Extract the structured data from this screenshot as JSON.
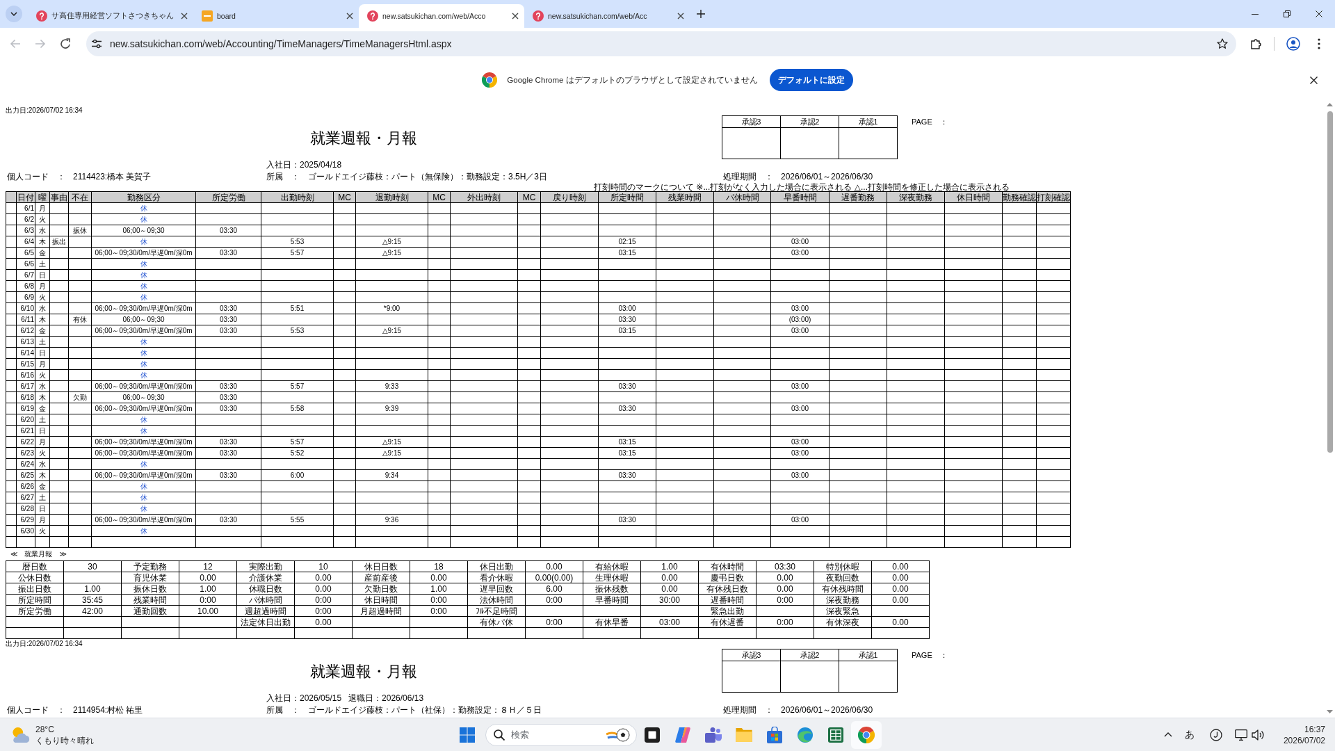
{
  "browser": {
    "tabs": [
      {
        "title": "サ高住専用経営ソフトさつきちゃん",
        "kind": "help",
        "selected": false
      },
      {
        "title": "board",
        "kind": "board",
        "selected": false
      },
      {
        "title": "new.satsukichan.com/web/Acco",
        "kind": "help",
        "selected": true
      },
      {
        "title": "new.satsukichan.com/web/Acc",
        "kind": "help",
        "selected": false
      }
    ],
    "nav": [
      {
        "kind": "back",
        "disabled": true
      },
      {
        "kind": "forward",
        "disabled": true
      },
      {
        "kind": "reload",
        "disabled": false
      }
    ],
    "url": "new.satsukichan.com/web/Accounting/TimeManagers/TimeManagersHtml.aspx"
  },
  "infobar": {
    "message": "Google Chrome はデフォルトのブラウザとして設定されていません",
    "button": "デフォルトに設定"
  },
  "reports": [
    {
      "output_date": "出力日:2026/07/02 16:34",
      "title": "就業週報・月報",
      "approvals": [
        "承認3",
        "承認2",
        "承認1"
      ],
      "page_label": "PAGE　：",
      "dates": [
        "入社日：2025/04/18"
      ],
      "employee": {
        "label": "個人コード　：",
        "value": "2114423:橋本 美賀子"
      },
      "department": {
        "label": "所属　：",
        "value": "ゴールドエイジ藤枝：パート（無保険）：勤務設定：3.5H／3日"
      },
      "period": {
        "label": "処理期間　：",
        "value": "2026/06/01～2026/06/30"
      },
      "note": "打刻時間のマークについて ※...打刻がなく入力した場合に表示される △...打刻時間を修正した場合に表示される",
      "table": {
        "columns": [
          "日付",
          "曜",
          "事由",
          "不在",
          "勤務区分",
          "所定労働",
          "出勤時刻",
          "MC",
          "退勤時刻",
          "MC",
          "外出時刻",
          "MC",
          "戻り時刻",
          "所定時間",
          "残業時間",
          "パ休時間",
          "早番時間",
          "遅番勤務",
          "深夜勤務",
          "休日時間",
          "勤務確認",
          "打刻確認"
        ],
        "rows": [
          {
            "kind": "rest",
            "date": "6/1",
            "weekday": "月",
            "shift": "休"
          },
          {
            "kind": "rest",
            "date": "6/2",
            "weekday": "火",
            "shift": "休"
          },
          {
            "kind": "work",
            "date": "6/3",
            "weekday": "水",
            "absence": "振休",
            "shift": "06;00～09;30",
            "labor": "03:30"
          },
          {
            "kind": "rest",
            "date": "6/4",
            "weekday": "木",
            "reason": "振出",
            "shift": "休",
            "clock_in": "5:53",
            "clock_out": "△9:15",
            "scheduled": "02:15",
            "early": "03:00"
          },
          {
            "kind": "work",
            "date": "6/5",
            "weekday": "金",
            "shift": "06;00～09;30/0m/早遅0m/深0m",
            "labor": "03:30",
            "clock_in": "5:57",
            "clock_out": "△9:15",
            "scheduled": "03:15",
            "early": "03:00"
          },
          {
            "kind": "rest",
            "date": "6/6",
            "weekday": "土",
            "shift": "休"
          },
          {
            "kind": "rest",
            "date": "6/7",
            "weekday": "日",
            "shift": "休"
          },
          {
            "kind": "rest",
            "date": "6/8",
            "weekday": "月",
            "shift": "休"
          },
          {
            "kind": "rest",
            "date": "6/9",
            "weekday": "火",
            "shift": "休"
          },
          {
            "kind": "work",
            "date": "6/10",
            "weekday": "水",
            "shift": "06;00～09;30/0m/早遅0m/深0m",
            "labor": "03:30",
            "clock_in": "5:51",
            "clock_out": "*9:00",
            "scheduled": "03:00",
            "early": "03:00"
          },
          {
            "kind": "work",
            "date": "6/11",
            "weekday": "木",
            "absence": "有休",
            "shift": "06;00～09;30",
            "labor": "03:30",
            "scheduled": "03:30",
            "early": "(03:00)"
          },
          {
            "kind": "work",
            "date": "6/12",
            "weekday": "金",
            "shift": "06;00～09;30/0m/早遅0m/深0m",
            "labor": "03:30",
            "clock_in": "5:53",
            "clock_out": "△9:15",
            "scheduled": "03:15",
            "early": "03:00"
          },
          {
            "kind": "rest",
            "date": "6/13",
            "weekday": "土",
            "shift": "休"
          },
          {
            "kind": "rest",
            "date": "6/14",
            "weekday": "日",
            "shift": "休"
          },
          {
            "kind": "rest",
            "date": "6/15",
            "weekday": "月",
            "shift": "休"
          },
          {
            "kind": "rest",
            "date": "6/16",
            "weekday": "火",
            "shift": "休"
          },
          {
            "kind": "work",
            "date": "6/17",
            "weekday": "水",
            "shift": "06;00～09;30/0m/早遅0m/深0m",
            "labor": "03:30",
            "clock_in": "5:57",
            "clock_out": "9:33",
            "scheduled": "03:30",
            "early": "03:00"
          },
          {
            "kind": "work",
            "date": "6/18",
            "weekday": "木",
            "absence": "欠勤",
            "shift": "06;00～09;30",
            "labor": "03:30"
          },
          {
            "kind": "work",
            "date": "6/19",
            "weekday": "金",
            "shift": "06;00～09;30/0m/早遅0m/深0m",
            "labor": "03:30",
            "clock_in": "5:58",
            "clock_out": "9:39",
            "scheduled": "03:30",
            "early": "03:00"
          },
          {
            "kind": "rest",
            "date": "6/20",
            "weekday": "土",
            "shift": "休"
          },
          {
            "kind": "rest",
            "date": "6/21",
            "weekday": "日",
            "shift": "休"
          },
          {
            "kind": "work",
            "date": "6/22",
            "weekday": "月",
            "shift": "06;00～09;30/0m/早遅0m/深0m",
            "labor": "03:30",
            "clock_in": "5:57",
            "clock_out": "△9:15",
            "scheduled": "03:15",
            "early": "03:00"
          },
          {
            "kind": "work",
            "date": "6/23",
            "weekday": "火",
            "shift": "06;00～09;30/0m/早遅0m/深0m",
            "labor": "03:30",
            "clock_in": "5:52",
            "clock_out": "△9:15",
            "scheduled": "03:15",
            "early": "03:00"
          },
          {
            "kind": "rest",
            "date": "6/24",
            "weekday": "水",
            "shift": "休"
          },
          {
            "kind": "work",
            "date": "6/25",
            "weekday": "木",
            "shift": "06;00～09;30/0m/早遅0m/深0m",
            "labor": "03:30",
            "clock_in": "6:00",
            "clock_out": "9:34",
            "scheduled": "03:30",
            "early": "03:00"
          },
          {
            "kind": "rest",
            "date": "6/26",
            "weekday": "金",
            "shift": "休"
          },
          {
            "kind": "rest",
            "date": "6/27",
            "weekday": "土",
            "shift": "休"
          },
          {
            "kind": "rest",
            "date": "6/28",
            "weekday": "日",
            "shift": "休"
          },
          {
            "kind": "work",
            "date": "6/29",
            "weekday": "月",
            "shift": "06;00～09;30/0m/早遅0m/深0m",
            "labor": "03:30",
            "clock_in": "5:55",
            "clock_out": "9:36",
            "scheduled": "03:30",
            "early": "03:00"
          },
          {
            "kind": "rest",
            "date": "6/30",
            "weekday": "火",
            "shift": "休"
          }
        ]
      },
      "summary": {
        "prev": "≪",
        "title": "就業月報",
        "next": "≫",
        "rows": [
          [
            {
              "label": "暦日数",
              "value": "30"
            },
            {
              "label": "予定勤務",
              "value": "12"
            },
            {
              "label": "実際出勤",
              "value": "10"
            },
            {
              "label": "休日日数",
              "value": "18"
            },
            {
              "label": "休日出勤",
              "value": "0.00"
            },
            {
              "label": "有給休暇",
              "value": "1.00"
            },
            {
              "label": "有休時間",
              "value": "03:30"
            },
            {
              "label": "特別休暇",
              "value": "0.00"
            }
          ],
          [
            {
              "label": "公休日数"
            },
            {
              "label": "育児休業",
              "value": "0.00"
            },
            {
              "label": "介護休業",
              "value": "0.00"
            },
            {
              "label": "産前産後",
              "value": "0.00"
            },
            {
              "label": "看介休暇",
              "value": "0.00(0.00)"
            },
            {
              "label": "生理休暇",
              "value": "0.00"
            },
            {
              "label": "慶弔日数",
              "value": "0.00"
            },
            {
              "label": "夜勤回数",
              "value": "0.00"
            }
          ],
          [
            {
              "label": "振出日数",
              "value": "1.00"
            },
            {
              "label": "振休日数",
              "value": "1.00"
            },
            {
              "label": "休職日数",
              "value": "0.00"
            },
            {
              "label": "欠勤日数",
              "value": "1.00"
            },
            {
              "label": "遅早回数",
              "value": "6.00"
            },
            {
              "label": "振休残数",
              "value": "0.00"
            },
            {
              "label": "有休残日数",
              "value": "0.00"
            },
            {
              "label": "有休残時間",
              "value": "0.00"
            }
          ],
          [
            {
              "label": "所定時間",
              "value": "35:45"
            },
            {
              "label": "残業時間",
              "value": "0:00"
            },
            {
              "label": "パ休時間",
              "value": "0:00"
            },
            {
              "label": "休日時間",
              "value": "0:00"
            },
            {
              "label": "法休時間",
              "value": "0:00"
            },
            {
              "label": "早番時間",
              "value": "30:00"
            },
            {
              "label": "遅番時間",
              "value": "0:00"
            },
            {
              "label": "深夜勤務",
              "value": "0.00"
            }
          ],
          [
            {
              "label": "所定労働",
              "value": "42:00"
            },
            {
              "label": "通勤回数",
              "value": "10.00"
            },
            {
              "label": "週超過時間",
              "value": "0:00"
            },
            {
              "label": "月超過時間",
              "value": "0:00"
            },
            {
              "label": "ﾌﾙ不足時間"
            },
            {},
            {
              "label": "緊急出勤"
            },
            {
              "label": "深夜緊急"
            }
          ],
          [
            {},
            {},
            {
              "label": "法定休日出勤",
              "value": "0.00"
            },
            {},
            {
              "label": "有休パ休",
              "value": "0:00"
            },
            {
              "label": "有休早番",
              "value": "03:00"
            },
            {
              "label": "有休遅番",
              "value": "0:00"
            },
            {
              "label": "有休深夜",
              "value": "0.00"
            }
          ]
        ]
      }
    },
    {
      "output_date": "出力日:2026/07/02 16:34",
      "title": "就業週報・月報",
      "approvals": [
        "承認3",
        "承認2",
        "承認1"
      ],
      "page_label": "PAGE　：",
      "dates": [
        "入社日：2026/05/15",
        "退職日：2026/06/13"
      ],
      "employee": {
        "label": "個人コード　：",
        "value": "2114954:村松 祐里"
      },
      "department": {
        "label": "所属　：",
        "value": "ゴールドエイジ藤枝：パート（社保）：勤務設定：８Ｈ／５日"
      },
      "period": {
        "label": "処理期間　：",
        "value": "2026/06/01～2026/06/30"
      }
    }
  ],
  "taskbar": {
    "weather": {
      "temperature": "28°C",
      "condition": "くもり時々晴れ"
    },
    "search": {
      "placeholder": "検索"
    },
    "apps": [
      {
        "kind": "taskview",
        "selected": false
      },
      {
        "kind": "assistant",
        "selected": false
      },
      {
        "kind": "chat",
        "selected": false
      },
      {
        "kind": "folder",
        "selected": false
      },
      {
        "kind": "store",
        "selected": false
      },
      {
        "kind": "wave_browser",
        "selected": false
      },
      {
        "kind": "spreadsheet",
        "selected": false
      },
      {
        "kind": "browser",
        "selected": true
      }
    ],
    "ime": "あ",
    "time": "16:37",
    "date": "2026/07/02"
  }
}
